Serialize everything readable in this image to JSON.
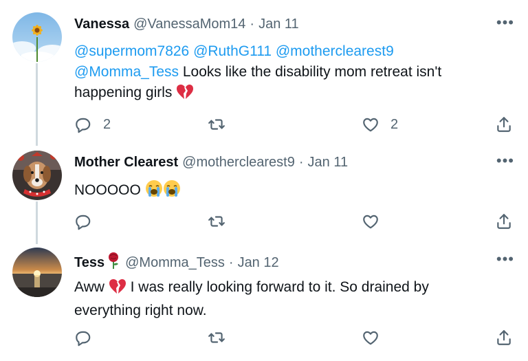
{
  "tweets": [
    {
      "name": "Vanessa",
      "handle": "@VanessaMom14",
      "date": "Jan 11",
      "more": "•••",
      "mentions_line1": [
        "@supermom7826",
        "@RuthG111",
        "@motherclearest9"
      ],
      "mention_line2": "@Momma_Tess",
      "text_line2": " Looks like the disability mom retreat isn't",
      "text_line3": "happening girls ",
      "emoji_text": "broken-heart-emoji",
      "reply_count": "2",
      "retweet_count": "",
      "like_count": "2"
    },
    {
      "name": "Mother Clearest",
      "handle": "@motherclearest9",
      "date": "Jan 11",
      "more": "•••",
      "text": "NOOOOO ",
      "emoji_text": "loudly-crying-face-emoji x2",
      "reply_count": "",
      "retweet_count": "",
      "like_count": ""
    },
    {
      "name": "Tess",
      "name_emoji": "rose-emoji",
      "handle": "@Momma_Tess",
      "date": "Jan 12",
      "more": "•••",
      "text_prefix": "Aww ",
      "text_line1": " I was really looking forward to it. So drained by",
      "text_line2": "everything right now.",
      "emoji_text": "broken-heart-emoji",
      "reply_count": "",
      "retweet_count": "",
      "like_count": ""
    }
  ],
  "dot": "·",
  "colors": {
    "mention": "#1d9bf0",
    "secondary_text": "#536471",
    "thread_line": "#cfd9de"
  },
  "icons": [
    "reply-icon",
    "retweet-icon",
    "like-icon",
    "share-icon",
    "more-icon"
  ]
}
